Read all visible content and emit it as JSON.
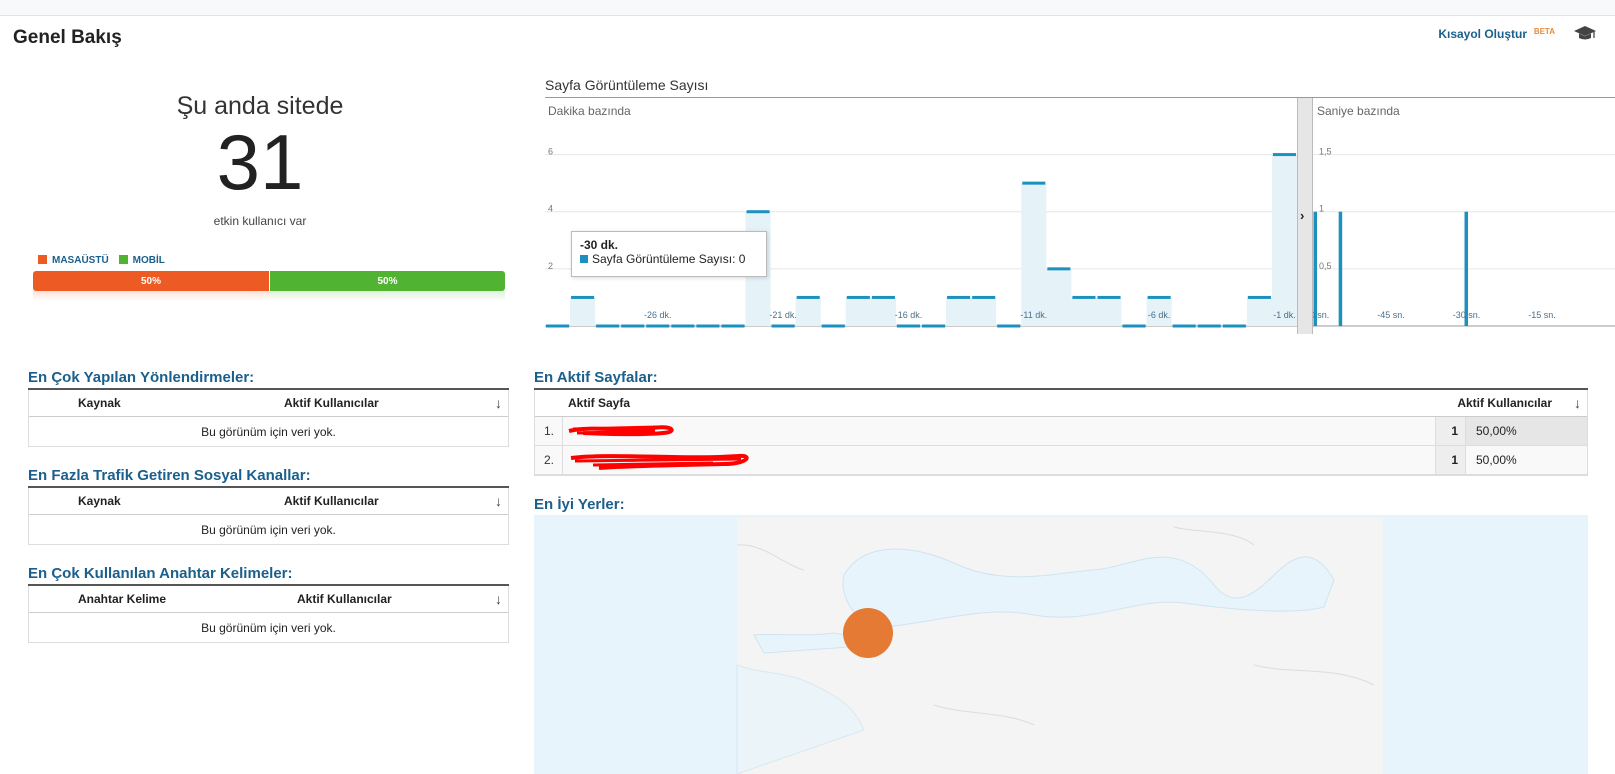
{
  "header": {
    "title": "Genel Bakış",
    "shortcut_label": "Kısayol Oluştur",
    "beta_label": "BETA"
  },
  "live": {
    "label": "Şu anda sitede",
    "count": "31",
    "sub": "etkin kullanıcı var",
    "desktop_label": "MASAÜSTÜ",
    "mobile_label": "MOBİL",
    "desktop_pct": "50%",
    "mobile_pct": "50%",
    "desktop_fraction": 0.5,
    "colors": {
      "desktop": "#ee5a24",
      "mobile": "#50b432"
    }
  },
  "chart": {
    "title": "Sayfa Görüntüleme Sayısı",
    "minute_label": "Dakika bazında",
    "second_label": "Saniye bazında",
    "tooltip_title": "-30 dk.",
    "tooltip_series": "Sayfa Görüntüleme Sayısı:",
    "tooltip_value": "0"
  },
  "chart_data": [
    {
      "type": "bar",
      "title": "Dakika bazında",
      "series_color": "#1c91c0",
      "ylim": [
        0,
        7
      ],
      "yticks": [
        2,
        4,
        6
      ],
      "x": [
        -30,
        -29,
        -28,
        -27,
        -26,
        -25,
        -24,
        -23,
        -22,
        -21,
        -20,
        -19,
        -18,
        -17,
        -16,
        -15,
        -14,
        -13,
        -12,
        -11,
        -10,
        -9,
        -8,
        -7,
        -6,
        -5,
        -4,
        -3,
        -2,
        -1
      ],
      "values": [
        0,
        1,
        0,
        0,
        0,
        0,
        0,
        0,
        4,
        0,
        1,
        0,
        1,
        1,
        0,
        0,
        1,
        1,
        0,
        5,
        2,
        1,
        1,
        0,
        1,
        0,
        0,
        0,
        1,
        6
      ],
      "xtick_labels": [
        {
          "x": -26,
          "label": "-26 dk."
        },
        {
          "x": -21,
          "label": "-21 dk."
        },
        {
          "x": -16,
          "label": "-16 dk."
        },
        {
          "x": -11,
          "label": "-11 dk."
        },
        {
          "x": -6,
          "label": "-6 dk."
        },
        {
          "x": -1,
          "label": "-1 dk."
        }
      ]
    },
    {
      "type": "bar",
      "title": "Saniye bazında",
      "series_color": "#1c91c0",
      "ylim": [
        0,
        1.75
      ],
      "yticks": [
        0.5,
        1,
        1.5
      ],
      "ytick_labels": [
        "0,5",
        "1",
        "1,5"
      ],
      "x": [
        -60,
        -59,
        -58,
        -57,
        -56,
        -55,
        -54,
        -53,
        -52,
        -51,
        -50,
        -49,
        -48,
        -47,
        -46,
        -45,
        -44,
        -43,
        -42,
        -41,
        -40,
        -39,
        -38,
        -37,
        -36,
        -35,
        -34,
        -33,
        -32,
        -31,
        -30,
        -29,
        -28,
        -27,
        -26,
        -25,
        -24,
        -23,
        -22,
        -21,
        -20,
        -19,
        -18,
        -17,
        -16,
        -15,
        -14,
        -13,
        -12,
        -11,
        -10,
        -9,
        -8,
        -7,
        -6,
        -5,
        -4,
        -3,
        -2,
        -1
      ],
      "values": [
        1,
        0,
        0,
        0,
        0,
        1,
        0,
        0,
        0,
        0,
        0,
        0,
        0,
        0,
        0,
        0,
        0,
        0,
        0,
        0,
        0,
        0,
        0,
        0,
        0,
        0,
        0,
        0,
        0,
        0,
        1,
        0,
        0,
        0,
        0,
        0,
        0,
        0,
        0,
        0,
        0,
        0,
        0,
        0,
        0,
        0,
        0,
        0,
        0,
        0,
        0,
        0,
        0,
        0,
        0,
        0,
        0,
        0,
        0,
        0
      ],
      "xtick_labels": [
        {
          "x": -60,
          "label": "-60 sn."
        },
        {
          "x": -45,
          "label": "-45 sn."
        },
        {
          "x": -30,
          "label": "-30 sn."
        },
        {
          "x": -15,
          "label": "-15 sn."
        }
      ]
    }
  ],
  "referrals": {
    "title": "En Çok Yapılan Yönlendirmeler:",
    "col1": "Kaynak",
    "col2": "Aktif Kullanıcılar",
    "empty": "Bu görünüm için veri yok."
  },
  "social": {
    "title": "En Fazla Trafik Getiren Sosyal Kanallar:",
    "col1": "Kaynak",
    "col2": "Aktif Kullanıcılar",
    "empty": "Bu görünüm için veri yok."
  },
  "keywords": {
    "title": "En Çok Kullanılan Anahtar Kelimeler:",
    "col1": "Anahtar Kelime",
    "col2": "Aktif Kullanıcılar",
    "empty": "Bu görünüm için veri yok."
  },
  "pages": {
    "title": "En Aktif Sayfalar:",
    "col1": "Aktif Sayfa",
    "col2": "Aktif Kullanıcılar",
    "rows": [
      {
        "idx": "1.",
        "count": "1",
        "pct": "50,00%"
      },
      {
        "idx": "2.",
        "count": "1",
        "pct": "50,00%"
      }
    ]
  },
  "locations": {
    "title": "En İyi Yerler:",
    "marker_color": "#e47a33"
  }
}
